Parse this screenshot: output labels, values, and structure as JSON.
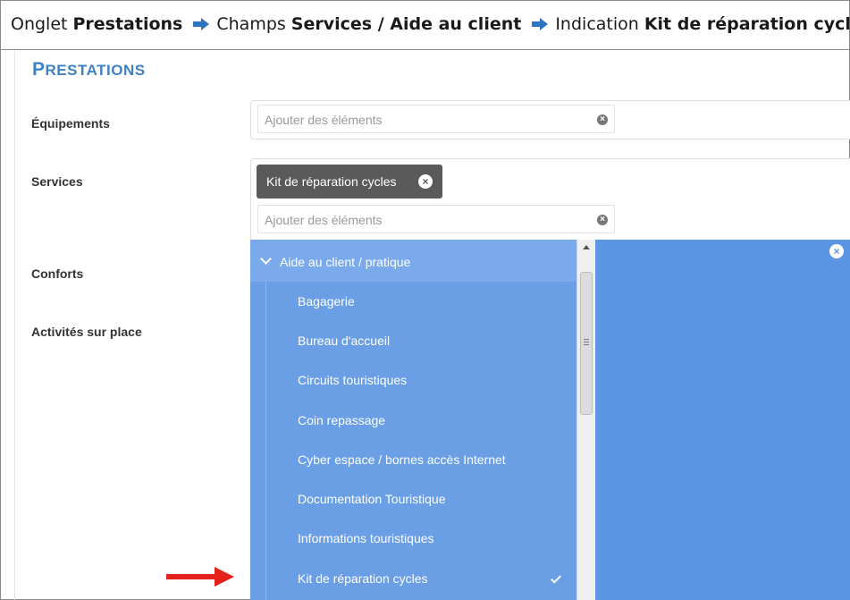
{
  "breadcrumb": {
    "tab_prefix": "Onglet",
    "tab_name": "Prestations",
    "field_prefix": "Champs",
    "field_name": "Services / Aide au client",
    "indication_prefix": "Indication",
    "indication_name": "Kit de réparation cycles"
  },
  "section": {
    "title_initial": "P",
    "title_rest": "RESTATIONS"
  },
  "fields": {
    "equipements": {
      "label": "Équipements",
      "placeholder": "Ajouter des éléments"
    },
    "services": {
      "label": "Services",
      "selected_tags": [
        "Kit de réparation cycles"
      ],
      "placeholder": "Ajouter des éléments"
    },
    "conforts": {
      "label": "Conforts"
    },
    "activites": {
      "label": "Activités sur place"
    }
  },
  "dropdown": {
    "group_label": "Aide au client / pratique",
    "items": [
      "Bagagerie",
      "Bureau d'accueil",
      "Circuits touristiques",
      "Coin repassage",
      "Cyber espace / bornes accès Internet",
      "Documentation Touristique",
      "Informations touristiques",
      "Kit de réparation cycles"
    ],
    "selected_item": "Kit de réparation cycles"
  },
  "colors": {
    "accent": "#3f82c4",
    "dropdown_bg": "#6a9fe6",
    "annotation_arrow": "#e3221b"
  },
  "icons": [
    "arrow-right-icon",
    "clear-icon",
    "chevron-down-icon",
    "checkmark-icon",
    "scroll-up-icon"
  ]
}
